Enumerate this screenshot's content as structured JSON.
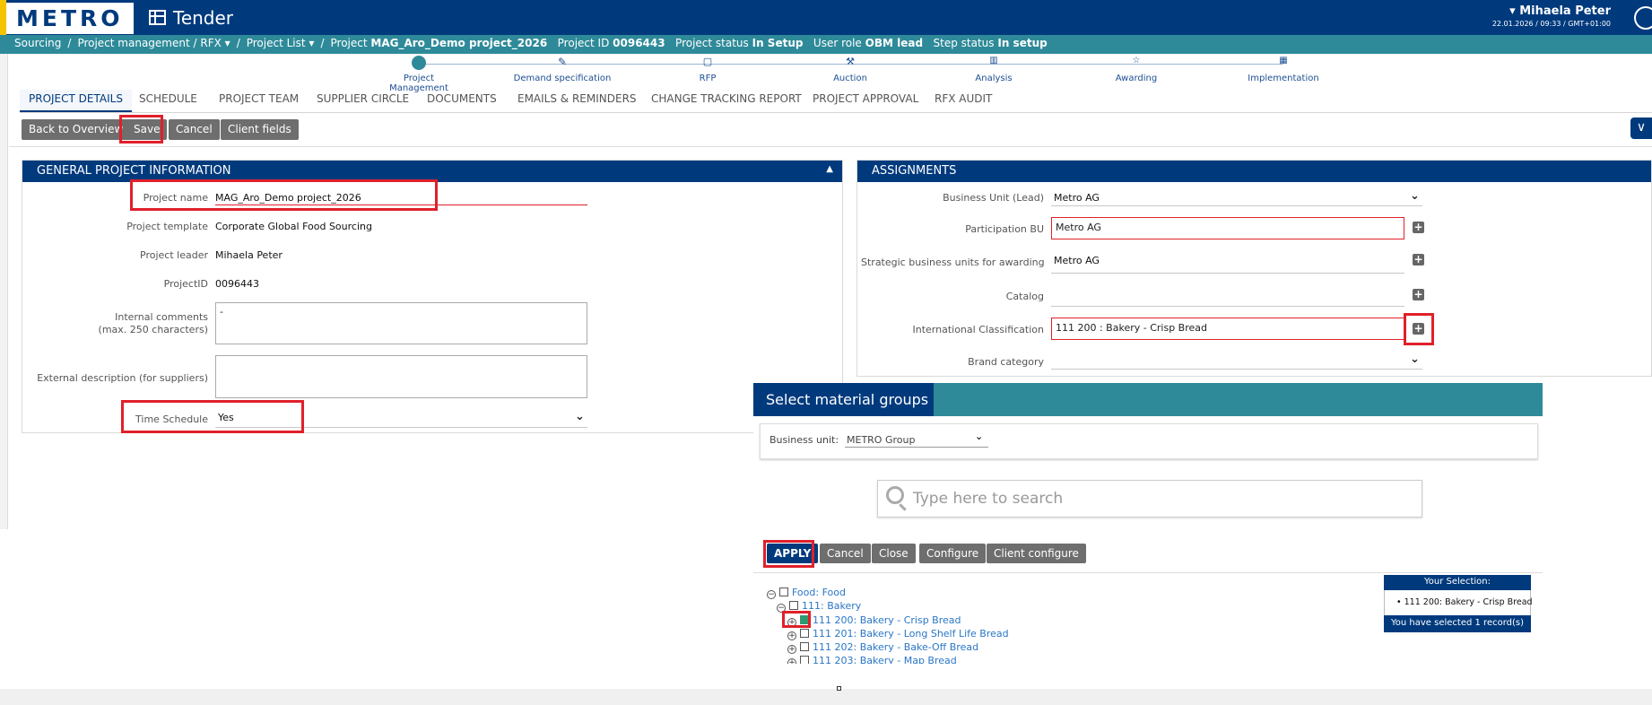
{
  "header": {
    "logo": "METRO",
    "app_title": "Tender",
    "user_name": "Mihaela Peter",
    "user_datetime": "22.01.2026 / 09:33 / GMT+01:00"
  },
  "breadcrumb": {
    "sourcing": "Sourcing",
    "project_management": "Project management / RFX",
    "project_list": "Project List",
    "project_prefix": "Project",
    "project_name": "MAG_Aro_Demo project_2026",
    "project_id_label": "Project ID",
    "project_id": "0096443",
    "status_label": "Project status",
    "status": "In Setup",
    "role_label": "User role",
    "role": "OBM lead",
    "step_label": "Step status",
    "step": "In setup"
  },
  "steps": [
    "Project Management",
    "Demand specification",
    "RFP",
    "Auction",
    "Analysis",
    "Awarding",
    "Implementation"
  ],
  "tabs": [
    "PROJECT DETAILS",
    "SCHEDULE",
    "PROJECT TEAM",
    "SUPPLIER CIRCLE",
    "DOCUMENTS",
    "EMAILS & REMINDERS",
    "CHANGE TRACKING REPORT",
    "PROJECT APPROVAL",
    "RFX AUDIT"
  ],
  "toolbar": {
    "back": "Back to Overview",
    "save": "Save",
    "cancel": "Cancel",
    "client_fields": "Client fields"
  },
  "general": {
    "title": "GENERAL PROJECT INFORMATION",
    "project_name_label": "Project name",
    "project_name": "MAG_Aro_Demo project_2026",
    "template_label": "Project template",
    "template": "Corporate Global Food Sourcing",
    "leader_label": "Project leader",
    "leader": "Mihaela Peter",
    "id_label": "ProjectID",
    "id": "0096443",
    "internal_label_1": "Internal comments",
    "internal_label_2": "(max. 250 characters)",
    "internal_value": "-",
    "external_label": "External description (for suppliers)",
    "schedule_label": "Time Schedule",
    "schedule": "Yes"
  },
  "assignments": {
    "title": "ASSIGNMENTS",
    "bu_lead_label": "Business Unit (Lead)",
    "bu_lead": "Metro AG",
    "participation_label": "Participation BU",
    "participation": "Metro AG",
    "strategic_label": "Strategic business units for awarding",
    "strategic": "Metro AG",
    "catalog_label": "Catalog",
    "intl_label": "International Classification",
    "intl": "111 200 : Bakery - Crisp Bread",
    "brand_label": "Brand category"
  },
  "dialog": {
    "title": "Select material groups",
    "bu_label": "Business unit:",
    "bu_value": "METRO Group",
    "search_placeholder": "Type here to search",
    "apply": "APPLY",
    "cancel": "Cancel",
    "close": "Close",
    "configure": "Configure",
    "client_configure": "Client configure",
    "tree": {
      "food": "Food: Food",
      "bakery": "111: Bakery",
      "n200": "111 200: Bakery - Crisp Bread",
      "n201": "111 201: Bakery - Long Shelf Life Bread",
      "n202": "111 202: Bakery - Bake-Off Bread",
      "n203": "111 203: Bakery - Map Bread"
    },
    "selection_title": "Your Selection:",
    "selection_item": "• 111 200: Bakery - Crisp Bread",
    "selection_count": "You have selected 1 record(s)"
  }
}
